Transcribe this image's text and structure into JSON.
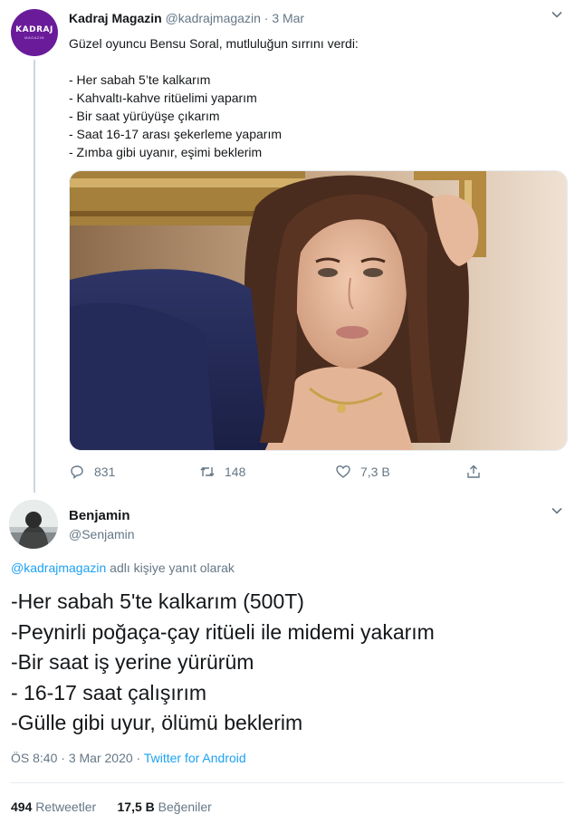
{
  "tweet": {
    "author_name": "Kadraj Magazin",
    "author_handle": "@kadrajmagazin",
    "separator": "·",
    "date": "3 Mar",
    "avatar_logo": "KADRAJ",
    "avatar_logo_sub": "MAGAZIN",
    "lines": [
      "Güzel oyuncu Bensu Soral, mutluluğun sırrını verdi:",
      "",
      "- Her sabah 5’te kalkarım",
      "- Kahvaltı-kahve ritüelimi yaparım",
      "- Bir saat yürüyüşe çıkarım",
      "- Saat 16-17 arası şekerleme yaparım",
      "- Zımba gibi uyanır, eşimi beklerim"
    ],
    "actions": {
      "replies": "831",
      "retweets": "148",
      "likes": "7,3 B"
    },
    "menu_icon": "chevron-down-icon"
  },
  "reply": {
    "author_name": "Benjamin",
    "author_handle": "@Senjamin",
    "reply_to_handle": "@kadrajmagazin",
    "reply_to_text": " adlı kişiye yanıt olarak",
    "lines": [
      "-Her sabah 5'te kalkarım (500T)",
      "-Peynirli poğaça-çay ritüeli ile midemi yakarım",
      "-Bir saat iş yerine yürürüm",
      "- 16-17 saat çalışırım",
      "-Gülle gibi uyur, ölümü beklerim"
    ],
    "time": "ÖS 8:40",
    "separator": " · ",
    "date": "3 Mar 2020",
    "source": "Twitter for Android",
    "retweet_count": "494",
    "retweet_label": "Retweetler",
    "like_count": "17,5 B",
    "like_label": "Beğeniler"
  },
  "colors": {
    "accent": "#1da1f2",
    "muted": "#657786",
    "text": "#14171a",
    "avatar_bg": "#6a1b9a"
  }
}
